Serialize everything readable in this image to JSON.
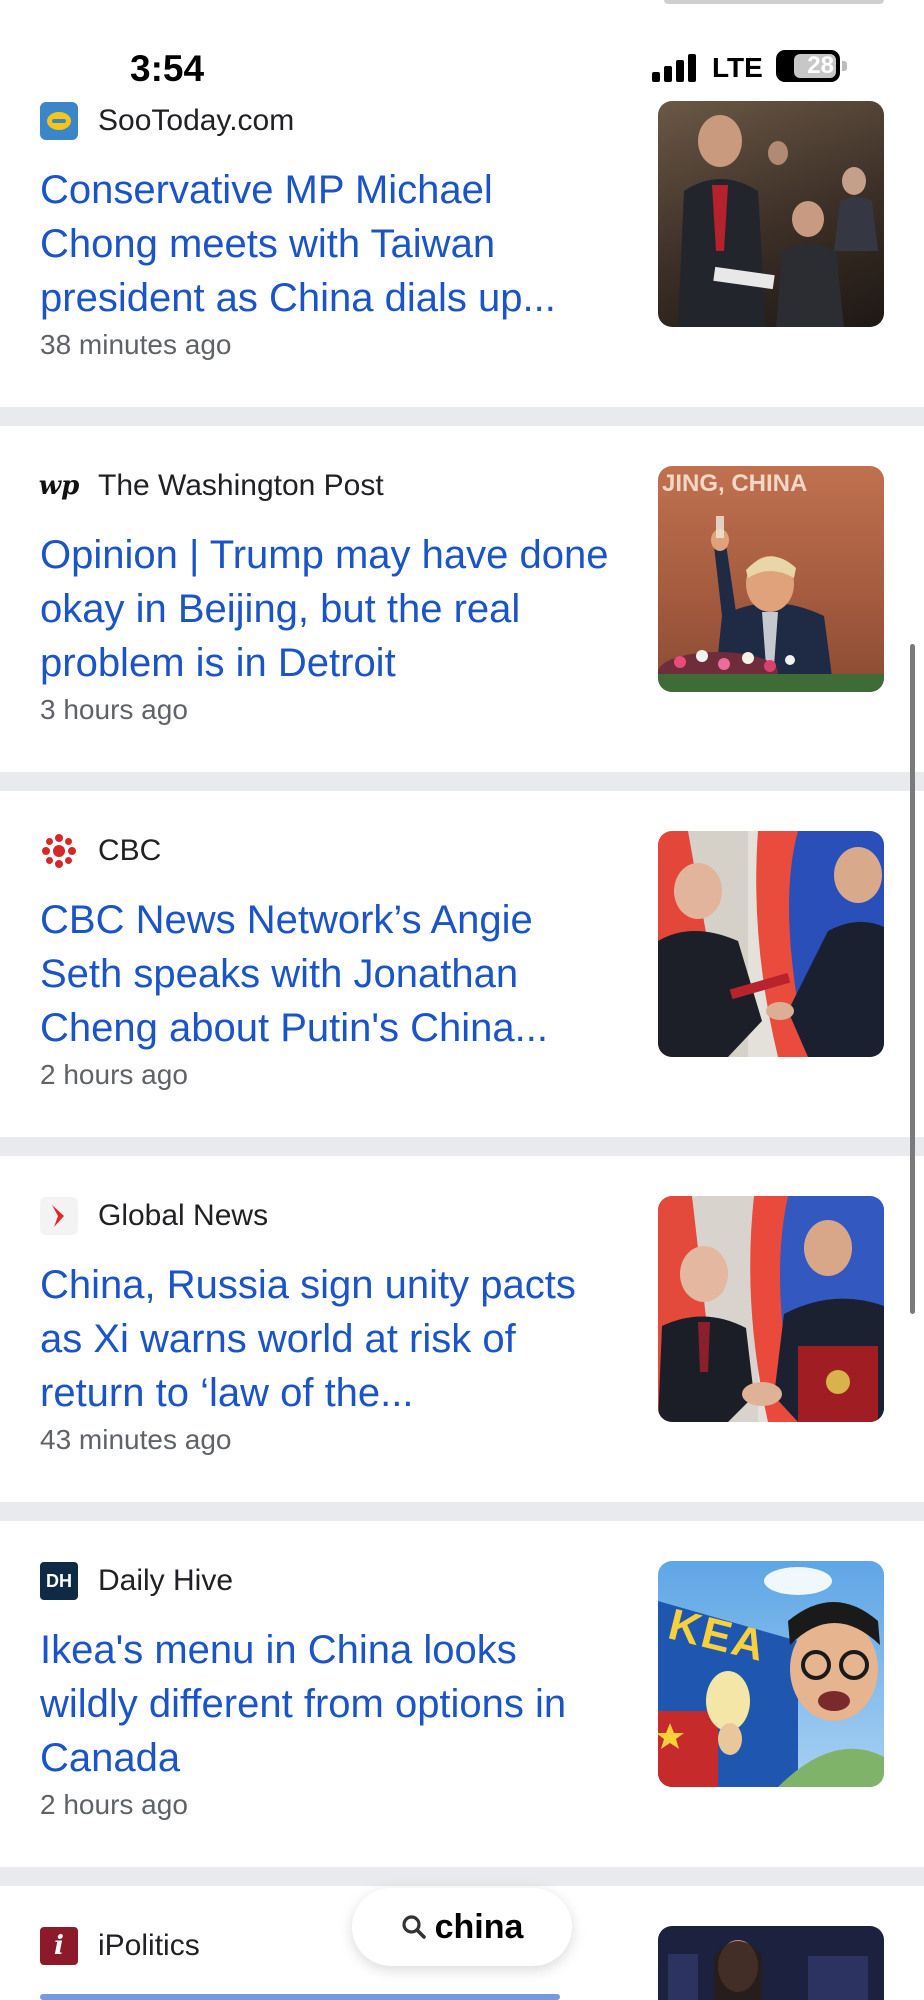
{
  "status_bar": {
    "time": "3:54",
    "network": "LTE",
    "battery": "28"
  },
  "articles": [
    {
      "source": "SooToday.com",
      "favicon": "sootoday-logo-icon",
      "headline": "Conservative MP Michael Chong meets with Taiwan president as China dials up...",
      "time": "38 minutes ago",
      "thumbnail": "parliament-speaker-photo"
    },
    {
      "source": "The Washington Post",
      "favicon": "wp-logo-icon",
      "favicon_text": "wp",
      "headline": "Opinion | Trump may have done okay in Beijing, but the real problem is in Detroit",
      "time": "3 hours ago",
      "thumbnail": "trump-toast-photo",
      "thumbnail_caption": "JING, CHINA"
    },
    {
      "source": "CBC",
      "favicon": "cbc-gem-icon",
      "headline": "CBC News Network’s Angie Seth speaks with Jonathan Cheng about Putin's China...",
      "time": "2 hours ago",
      "thumbnail": "putin-xi-handshake-photo"
    },
    {
      "source": "Global News",
      "favicon": "global-news-icon",
      "headline": "China, Russia sign unity pacts as Xi warns world at risk of return to ‘law of the...",
      "time": "43 minutes ago",
      "thumbnail": "putin-xi-folder-photo"
    },
    {
      "source": "Daily Hive",
      "favicon": "daily-hive-icon",
      "favicon_text": "DH",
      "headline": "Ikea's menu in China looks wildly different from options in Canada",
      "time": "2 hours ago",
      "thumbnail": "ikea-store-photo",
      "thumbnail_caption": "KEA"
    },
    {
      "source": "iPolitics",
      "favicon": "ipolitics-icon",
      "favicon_text": "i",
      "headline": "",
      "time": "",
      "thumbnail": "politician-photo"
    }
  ],
  "search": {
    "query": "china",
    "icon": "search-icon"
  },
  "colors": {
    "headline": "#1a54c8",
    "separator": "#e8eaed"
  }
}
